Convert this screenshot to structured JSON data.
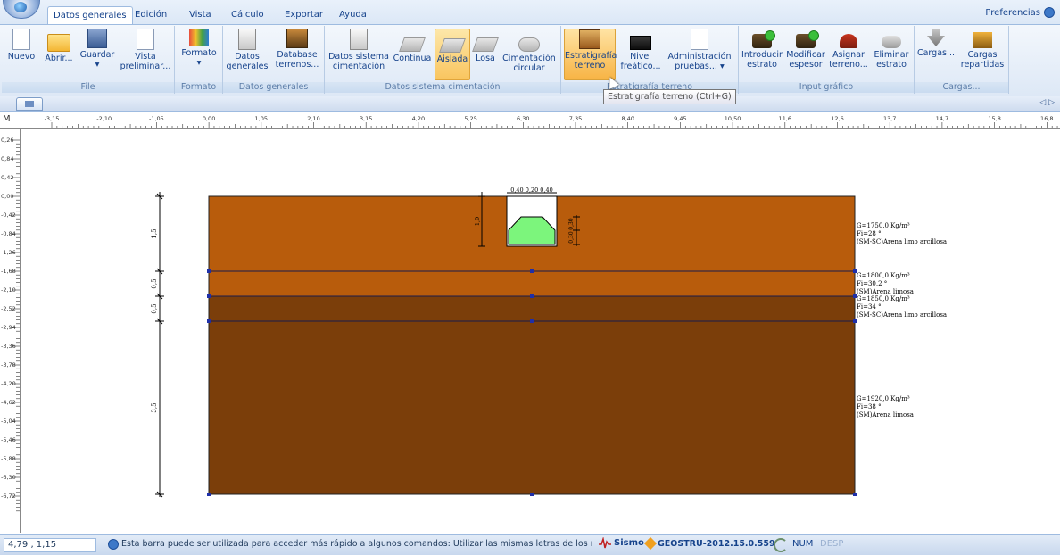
{
  "tabs": [
    "Datos generales",
    "Edición",
    "Vista",
    "Cálculo",
    "Exportar",
    "Ayuda"
  ],
  "preferences_label": "Preferencias",
  "ribbon": {
    "file": {
      "title": "File",
      "nuevo": "Nuevo",
      "abrir": "Abrir...",
      "guardar": "Guardar",
      "guardar2": "▾",
      "vista1": "Vista",
      "vista2": "preliminar..."
    },
    "formato": {
      "title": "Formato",
      "label": "Formato",
      "label2": "▾"
    },
    "datos_generales": {
      "title": "Datos generales",
      "datos1": "Datos",
      "datos2": "generales",
      "db1": "Database",
      "db2": "terrenos..."
    },
    "cimentacion": {
      "title": "Datos sistema cimentación",
      "sys1": "Datos sistema",
      "sys2": "cimentación",
      "continua": "Continua",
      "aislada": "Aislada",
      "losa": "Losa",
      "circ1": "Cimentación",
      "circ2": "circular"
    },
    "estrat": {
      "title": "Estratigrafía terreno",
      "est1": "Estratigrafía",
      "est2": "terreno",
      "niv1": "Nivel",
      "niv2": "freático...",
      "adm1": "Administración",
      "adm2": "pruebas... ▾"
    },
    "input": {
      "title": "Input gráfico",
      "intro1": "Introducir",
      "intro2": "estrato",
      "mod1": "Modificar",
      "mod2": "espesor",
      "asig1": "Asignar",
      "asig2": "terreno...",
      "elim1": "Eliminar",
      "elim2": "estrato"
    },
    "cargas": {
      "title": "Cargas...",
      "c1": "Cargas...",
      "c2a": "Cargas",
      "c2b": "repartidas"
    }
  },
  "tooltip": "Estratigrafía terreno (Ctrl+G)",
  "ruler": {
    "unit": "M",
    "h_ticks": [
      "-3,15",
      "-2,10",
      "-1,05",
      "0,00",
      "1,05",
      "2,10",
      "3,15",
      "4,20",
      "5,25",
      "6,30",
      "7,35",
      "8,40",
      "9,45",
      "10,50",
      "11,6",
      "12,6",
      "13,7",
      "14,7",
      "15,8",
      "16,8"
    ],
    "v_ticks": [
      "0,26",
      "0,84",
      "0,42",
      "0,00",
      "-0,42",
      "-0,84",
      "-1,26",
      "-1,68",
      "-2,10",
      "-2,52",
      "-2,94",
      "-3,36",
      "-3,78",
      "-4,20",
      "-4,62",
      "-5,04",
      "-5,46",
      "-5,88",
      "-6,30",
      "-6,72"
    ]
  },
  "layers": [
    {
      "thickness": "1,5",
      "color": "#b85c0c",
      "g": "G=1750,0 Kg/m³",
      "fi": "Fi=28 °",
      "soil": "(SM-SC)Arena limo arcillosa"
    },
    {
      "thickness": "0,5",
      "color": "#b85c0c",
      "g": "G=1800,0 Kg/m³",
      "fi": "Fi=30,2 °",
      "soil": "(SM)Arena limosa"
    },
    {
      "thickness": "0,5",
      "color": "#7b3e0a",
      "g": "G=1850,0 Kg/m³",
      "fi": "Fi=34 °",
      "soil": "(SM-SC)Arena limo arcillosa"
    },
    {
      "thickness": "3,5",
      "color": "#7b3e0a",
      "g": "G=1920,0 Kg/m³",
      "fi": "Fi=38 °",
      "soil": "(SM)Arena limosa"
    }
  ],
  "foundation": {
    "top_dims": "0,40 0,20 0,40",
    "depth": "1,0",
    "side": "0,30",
    "side2": "0,30"
  },
  "status": {
    "coords": "4,79 , 1,15",
    "message": "Esta barra puede ser utilizada para acceder más rápido a algunos comandos: Utilizar las mismas letras de los menús y con",
    "sismo": "Sismo",
    "version": "GEOSTRU-2012.15.0.559",
    "num": "NUM",
    "desp": "DESP"
  }
}
